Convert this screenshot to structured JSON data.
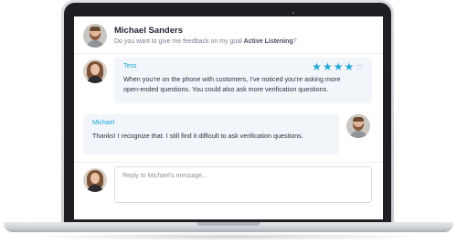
{
  "header": {
    "name": "Michael Sanders",
    "prompt_prefix": "Do you want to give me feedback on my goal",
    "goal": "Active Listening",
    "prompt_suffix": "?"
  },
  "messages": [
    {
      "author": "Tess",
      "rating": 4,
      "rating_max": 5,
      "text_line1": "When you’re on the phone with customers, I’ve noticed you’re asking more",
      "text_line2": "open-ended questions. You could also ask more verification questions."
    },
    {
      "author": "Michael",
      "text_line1": "Thanks! I recognize that. I still find it difficult to ask verification questions."
    }
  ],
  "reply": {
    "placeholder": "Reply to Michael’s message..."
  },
  "colors": {
    "accent": "#22a6d9",
    "bubble_bg": "#f2f6fa",
    "star_empty": "#c6ccd4"
  }
}
